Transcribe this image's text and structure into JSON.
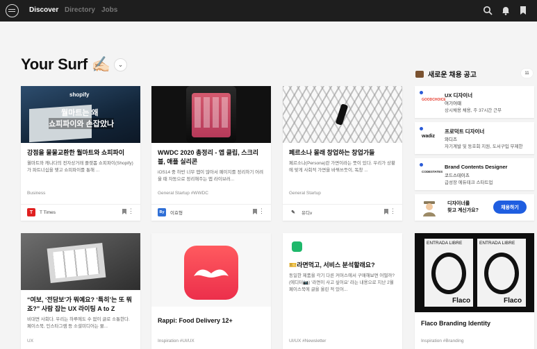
{
  "topbar": {
    "nav": [
      "Discover",
      "Directory",
      "Jobs"
    ]
  },
  "page": {
    "title": "Your Surf ✍🏻",
    "dropdown_icon": "chevron-down-icon"
  },
  "cards": [
    {
      "title": "강점을 물물교환한 월마트와 쇼피파이",
      "desc": "월마트와 캐나다의 전자상거래 플랫폼 쇼피파이(Shopify)가 파트너십을 맺고 쇼피파이를 통해 ...",
      "tags": "Business",
      "publisher": "T Times",
      "publisher_icon": "T",
      "publisher_color": "#e02020",
      "thumb_text_1": "월마트는 왜",
      "thumb_text_2": "쇼피파이와 손잡았나",
      "thumb_logo": "shopify"
    },
    {
      "title": "WWDC 2020 총정리 - 앱 클립, 스크리블, 애플 실리콘",
      "desc": "iOS14 중 하반 너무 앱이 많아서 페이지를 정리하기 어려울 때 자동으로 정리해주는 앱 라이브러...",
      "tags": "General Startup   #WWDC",
      "publisher": "이효형",
      "publisher_icon": "By",
      "publisher_color": "#2f6fd6"
    },
    {
      "title": "페르소나 몰래 창업하는 창업가들",
      "desc": "페르소나(Persona)란 가면이라는 뜻이 있다. 우리가 상황에 맞게 사회적 가면을 바꿔쓰듯이, 독창 ...",
      "tags": "General Startup",
      "publisher": "유디v",
      "publisher_icon": "✎",
      "publisher_color": "#ffffff"
    },
    {
      "title": "“여보, ‘전담보’가 뭐예요? ‘특히’는 또 뭐죠?” 사람 잡는 UX 라이팅 A to Z",
      "desc": "비대면 사회다. 우리는 하루에도 수 없이 글로 소통한다. 페이스북, 인스타그램 등 소셜미디어는 물...",
      "tags": "UX"
    },
    {
      "title": "Rappi: Food Delivery 12+",
      "desc": "",
      "tags": "Inspiration   #UI/UX"
    },
    {
      "title": "🎫라면먹고, 서비스 분석할래요?",
      "desc": "동일한 제품을 각기 다른 커머스에서 구매해보면 어떨까?(에디터📷) '라면이 사고 싶어요' 라는 내용으로 지난 2월 페이스북에 글을 올린 적 있어...",
      "tags": "UI/UX   #Newsletter"
    },
    {
      "title": "Flaco Branding Identity",
      "desc": "",
      "tags": "Inspiration   #Branding",
      "poster_text_1": "ENTRADA LIBRE",
      "poster_text_2": "Flaco",
      "poster_ring": "STOREARTGALLERY STUDIOCOOPS"
    }
  ],
  "sidebar": {
    "header": "새로운 채용 공고",
    "count": "11",
    "jobs": [
      {
        "title": "UX 디자이너",
        "company": "여기어때",
        "detail": "상시채용 채용, 주 37시간 근무",
        "logo": "GOODCHOICE",
        "logo_color": "#e63b2e"
      },
      {
        "title": "프로덕트 디자이너",
        "company": "와디즈",
        "detail": "자기계발 및 동호회 지원, 도서구입 무제한",
        "logo": "wadiz",
        "logo_color": "#111111"
      },
      {
        "title": "Brand Contents Designer",
        "company": "코드스테이츠",
        "detail": "급성장 에듀테크 스타트업",
        "logo": "CODESTATES",
        "logo_color": "#222222"
      }
    ],
    "promo": {
      "line1": "디자이너를",
      "line2": "찾고 계신가요?",
      "button": "채용하기"
    }
  }
}
